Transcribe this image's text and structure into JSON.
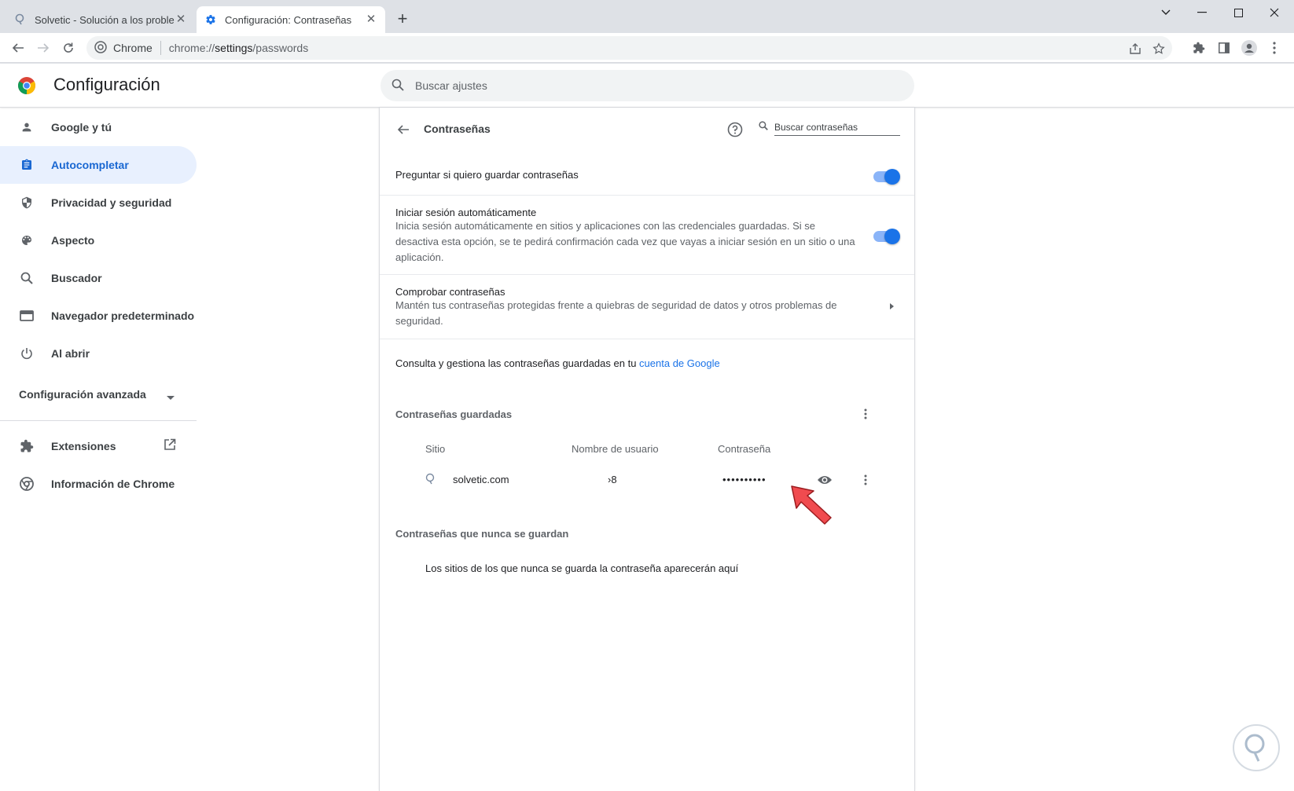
{
  "tabs": [
    {
      "label": "Solvetic - Solución a los problem",
      "icon": "solvetic-favicon"
    },
    {
      "label": "Configuración: Contraseñas",
      "icon": "gear-icon"
    }
  ],
  "omnibox": {
    "site": "Chrome",
    "url_prefix": "chrome://",
    "url_host": "settings",
    "url_path": "/passwords"
  },
  "header": {
    "title": "Configuración",
    "search_placeholder": "Buscar ajustes"
  },
  "sidebar": {
    "items": [
      {
        "label": "Google y tú",
        "icon": "person-icon"
      },
      {
        "label": "Autocompletar",
        "icon": "clipboard-icon",
        "selected": true
      },
      {
        "label": "Privacidad y seguridad",
        "icon": "shield-icon"
      },
      {
        "label": "Aspecto",
        "icon": "palette-icon"
      },
      {
        "label": "Buscador",
        "icon": "search-icon"
      },
      {
        "label": "Navegador predeterminado",
        "icon": "browser-icon"
      },
      {
        "label": "Al abrir",
        "icon": "power-icon"
      }
    ],
    "advanced": "Configuración avanzada",
    "extensions": "Extensiones",
    "about": "Información de Chrome"
  },
  "passwords": {
    "title": "Contraseñas",
    "search_placeholder": "Buscar contraseñas",
    "offer_save": {
      "title": "Preguntar si quiero guardar contraseñas",
      "on": true
    },
    "auto_signin": {
      "title": "Iniciar sesión automáticamente",
      "desc": "Inicia sesión automáticamente en sitios y aplicaciones con las credenciales guardadas. Si se desactiva esta opción, se te pedirá confirmación cada vez que vayas a iniciar sesión en un sitio o una aplicación.",
      "on": true
    },
    "check": {
      "title": "Comprobar contraseñas",
      "desc": "Mantén tus contraseñas protegidas frente a quiebras de seguridad de datos y otros problemas de seguridad."
    },
    "manage_text": "Consulta y gestiona las contraseñas guardadas en tu ",
    "manage_link": "cuenta de Google",
    "saved_title": "Contraseñas guardadas",
    "columns": {
      "site": "Sitio",
      "username": "Nombre de usuario",
      "password": "Contraseña"
    },
    "entries": [
      {
        "site": "solvetic.com",
        "username": "›8",
        "password": "••••••••••"
      }
    ],
    "never_title": "Contraseñas que nunca se guardan",
    "never_empty": "Los sitios de los que nunca se guarda la contraseña aparecerán aquí"
  },
  "colors": {
    "accent": "#1a73e8",
    "selected_bg": "#e8f0fe",
    "arrow": "#f04b4f"
  }
}
